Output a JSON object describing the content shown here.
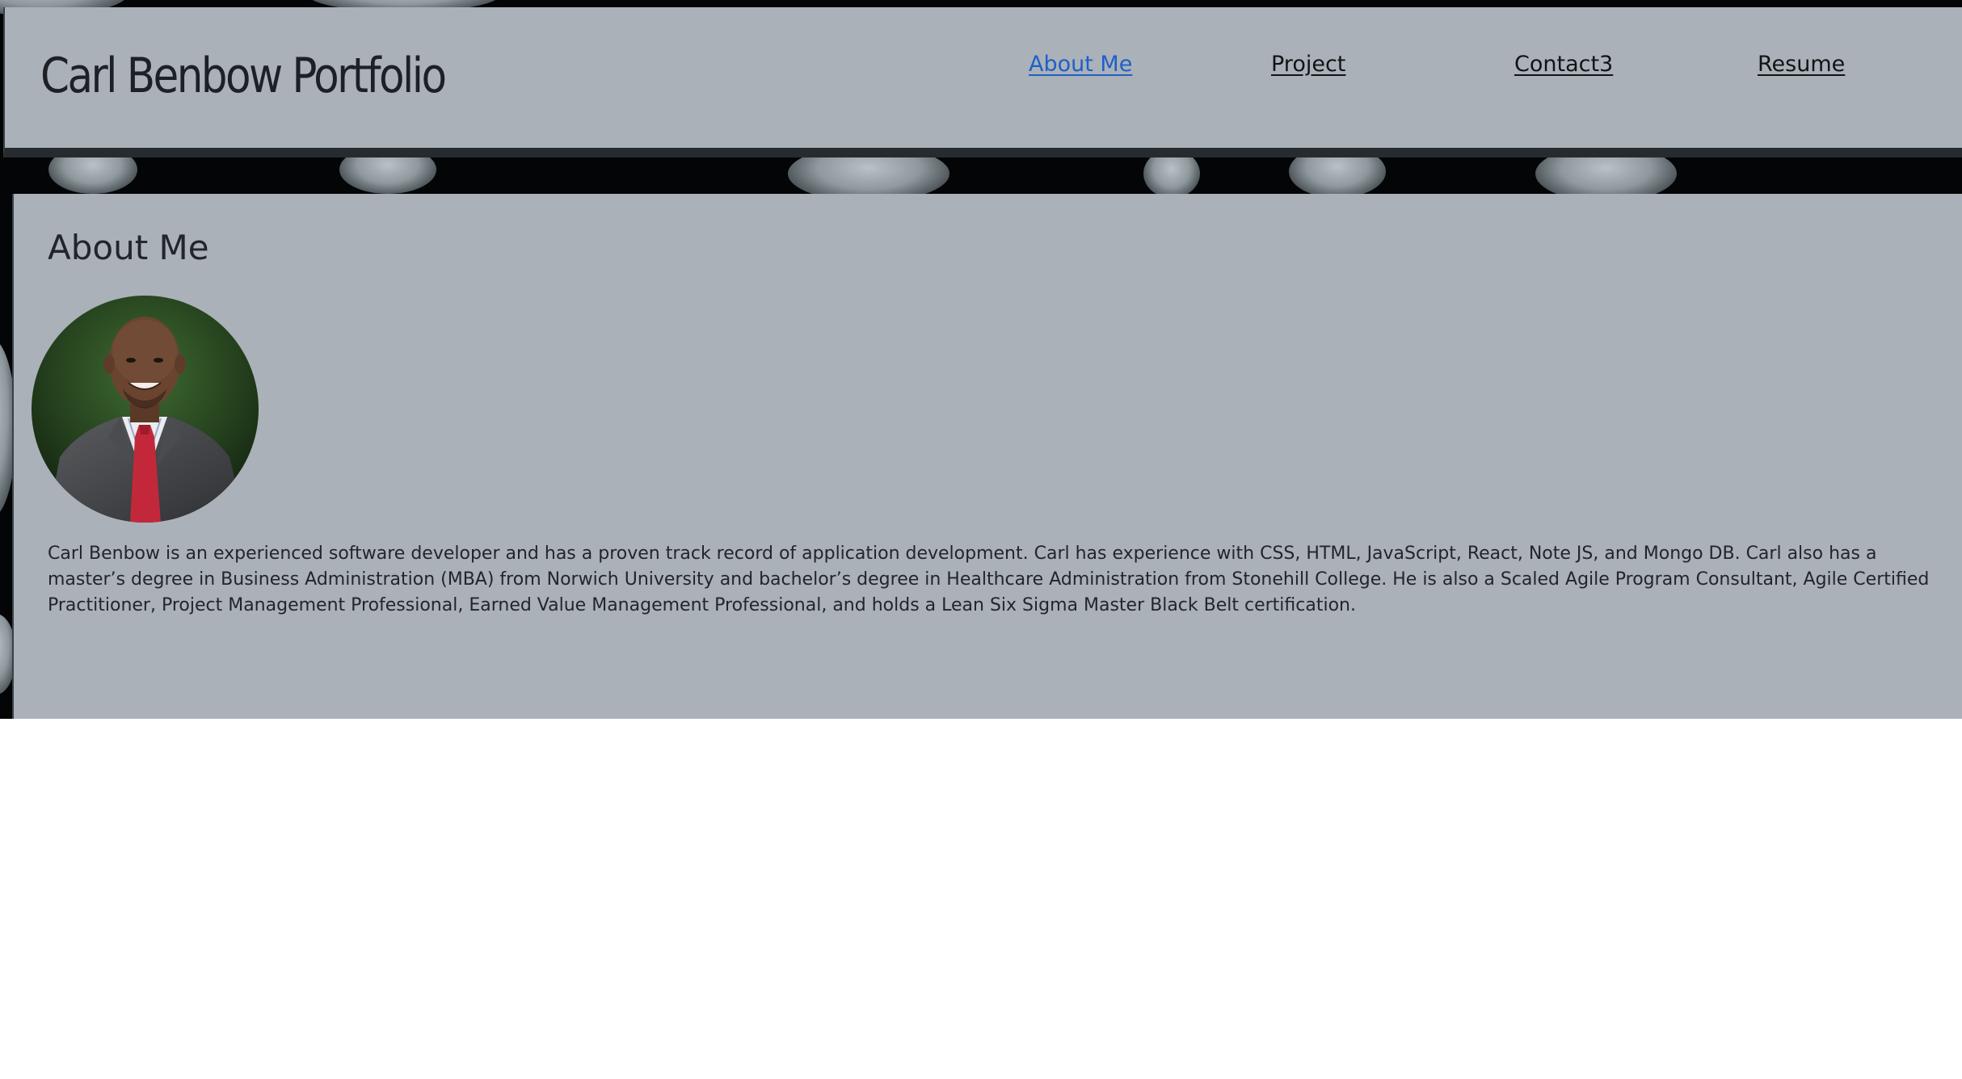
{
  "header": {
    "title": "Carl Benbow Portfolio"
  },
  "nav": {
    "items": [
      {
        "label": "About Me",
        "active": true
      },
      {
        "label": "Project",
        "active": false
      },
      {
        "label": "Contact3",
        "active": false
      },
      {
        "label": "Resume",
        "active": false
      }
    ]
  },
  "about": {
    "title": "About Me",
    "photo_icon": "profile-photo",
    "bio": "Carl Benbow is an experienced software developer and has a proven track record of application development. Carl has experience with CSS, HTML, JavaScript, React, Note JS, and Mongo DB. Carl also has a master’s degree in Business Administration (MBA) from Norwich University and bachelor’s degree in Healthcare Administration from Stonehill College. He is also a Scaled Agile Program Consultant, Agile Certified Practitioner, Project Management Professional, Earned Value Management Professional, and holds a Lean Six Sigma Master Black Belt certification."
  },
  "colors": {
    "panel": "#aab1b8",
    "active_link": "#1f5fc8",
    "backdrop": "#040506",
    "header_border": "#262b30"
  }
}
